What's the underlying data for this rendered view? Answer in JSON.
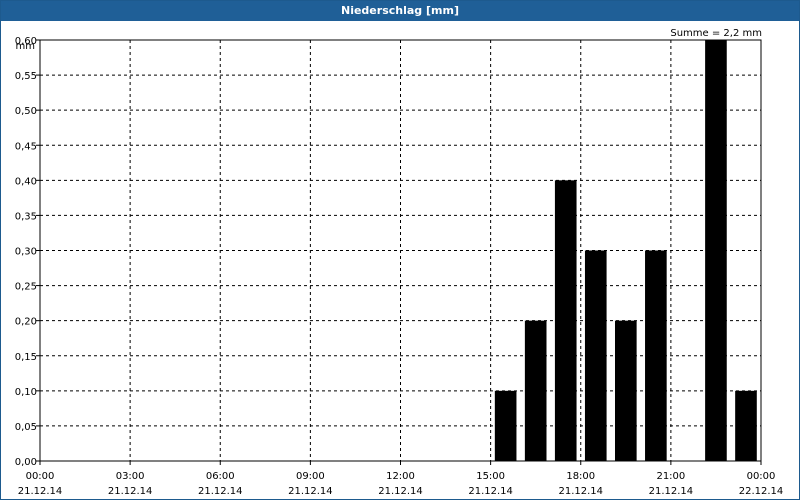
{
  "header": {
    "title": "Niederschlag [mm]"
  },
  "summary": {
    "total": "Summe = 2,2 mm"
  },
  "colors": {
    "titlebar": "#1f5f97",
    "bar": "#000000",
    "grid": "#000000"
  },
  "chart_data": {
    "type": "bar",
    "title": "Niederschlag [mm]",
    "ylabel": "mm",
    "xlabel": "",
    "ylim": [
      0,
      0.6
    ],
    "xlim_hours": [
      0,
      24
    ],
    "grid": true,
    "y_ticks": [
      "0,00",
      "0,05",
      "0,10",
      "0,15",
      "0,20",
      "0,25",
      "0,30",
      "0,35",
      "0,40",
      "0,45",
      "0,50",
      "0,55",
      "0,60"
    ],
    "x_ticks": [
      {
        "time": "00:00",
        "date": "21.12.14"
      },
      {
        "time": "03:00",
        "date": "21.12.14"
      },
      {
        "time": "06:00",
        "date": "21.12.14"
      },
      {
        "time": "09:00",
        "date": "21.12.14"
      },
      {
        "time": "12:00",
        "date": "21.12.14"
      },
      {
        "time": "15:00",
        "date": "21.12.14"
      },
      {
        "time": "18:00",
        "date": "21.12.14"
      },
      {
        "time": "21:00",
        "date": "21.12.14"
      },
      {
        "time": "00:00",
        "date": "22.12.14"
      }
    ],
    "bars": [
      {
        "hour": "15:00",
        "value": 0.1
      },
      {
        "hour": "16:00",
        "value": 0.2
      },
      {
        "hour": "17:00",
        "value": 0.4
      },
      {
        "hour": "18:00",
        "value": 0.3
      },
      {
        "hour": "19:00",
        "value": 0.2
      },
      {
        "hour": "20:00",
        "value": 0.3
      },
      {
        "hour": "22:00",
        "value": 0.6
      },
      {
        "hour": "23:00",
        "value": 0.1
      }
    ]
  }
}
